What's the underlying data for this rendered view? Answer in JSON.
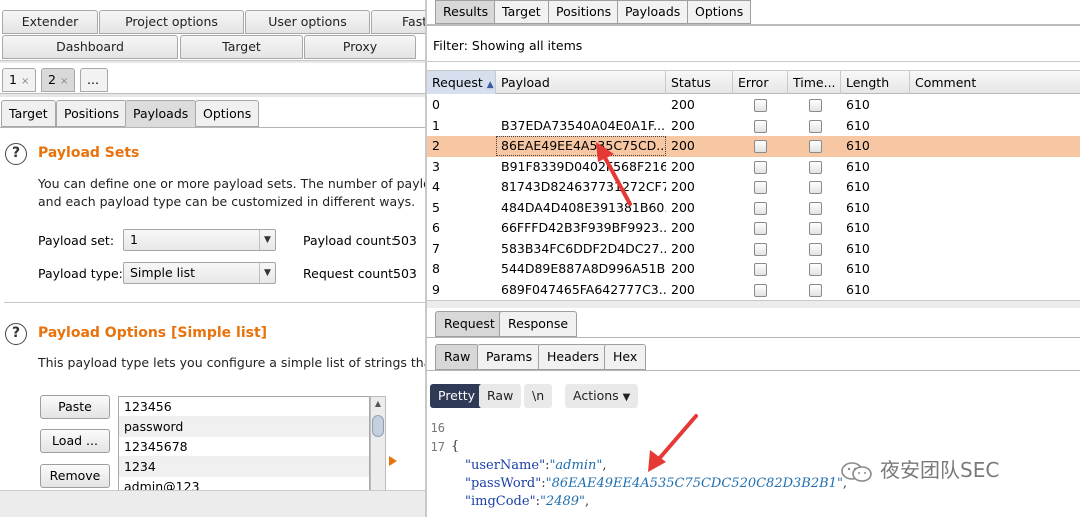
{
  "left": {
    "top_tabs_row1": [
      "Extender",
      "Project options",
      "User options",
      "Fast"
    ],
    "top_tabs_row2": [
      "Dashboard",
      "Target",
      "Proxy"
    ],
    "num_tabs": [
      {
        "label": "1",
        "close": "×"
      },
      {
        "label": "2",
        "close": "×"
      },
      {
        "label": "..."
      }
    ],
    "sub_tabs": [
      "Target",
      "Positions",
      "Payloads",
      "Options"
    ],
    "payload_sets": {
      "title": "Payload Sets",
      "desc1": "You can define one or more payload sets. The number of payload se",
      "desc2": "and each payload type can be customized in different ways.",
      "set_label": "Payload set:",
      "set_value": "1",
      "count_label": "Payload count:",
      "count_value": "503",
      "type_label": "Payload type:",
      "type_value": "Simple list",
      "req_label": "Request count:",
      "req_value": "503"
    },
    "payload_options": {
      "title": "Payload Options [Simple list]",
      "desc": "This payload type lets you configure a simple list of strings that are u",
      "buttons": [
        "Paste",
        "Load ...",
        "Remove"
      ],
      "items": [
        "123456",
        "password",
        "12345678",
        "1234",
        "admin@123"
      ]
    }
  },
  "right": {
    "tabs": [
      "Results",
      "Target",
      "Positions",
      "Payloads",
      "Options"
    ],
    "filter": "Filter: Showing all items",
    "columns": [
      "Request",
      "Payload",
      "Status",
      "Error",
      "Time...",
      "Length",
      "Comment"
    ],
    "sort_indicator": "▲",
    "rows": [
      {
        "req": "0",
        "payload": "",
        "status": "200",
        "length": "610"
      },
      {
        "req": "1",
        "payload": "B37EDA73540A04E0A1F...",
        "status": "200",
        "length": "610"
      },
      {
        "req": "2",
        "payload": "86EAE49EE4A535C75CD...",
        "status": "200",
        "length": "610"
      },
      {
        "req": "3",
        "payload": "B91F8339D0402F568F216...",
        "status": "200",
        "length": "610"
      },
      {
        "req": "4",
        "payload": "81743D824637731272CF7...",
        "status": "200",
        "length": "610"
      },
      {
        "req": "5",
        "payload": "484DA4D408E391381B60...",
        "status": "200",
        "length": "610"
      },
      {
        "req": "6",
        "payload": "66FFFD42B3F939BF9923...",
        "status": "200",
        "length": "610"
      },
      {
        "req": "7",
        "payload": "583B34FC6DDF2D4DC27...",
        "status": "200",
        "length": "610"
      },
      {
        "req": "8",
        "payload": "544D89E887A8D996A51B...",
        "status": "200",
        "length": "610"
      },
      {
        "req": "9",
        "payload": "689F047465FA642777C3...",
        "status": "200",
        "length": "610"
      }
    ],
    "selected_row": 2,
    "req_tabs": [
      "Request",
      "Response"
    ],
    "view_tabs": [
      "Raw",
      "Params",
      "Headers",
      "Hex"
    ],
    "format_buttons": {
      "pretty": "Pretty",
      "raw": "Raw",
      "newline": "\\n",
      "actions": "Actions"
    },
    "code": {
      "lines": [
        {
          "num": "16",
          "text": ""
        },
        {
          "num": "17",
          "text": "{"
        }
      ],
      "username_key": "\"userName\"",
      "username_val": "\"admin\"",
      "password_key": "\"passWord\"",
      "password_val": "\"86EAE49EE4A535C75CDC520C82D3B2B1\"",
      "imgcode_key": "\"imgCode\"",
      "imgcode_val": "\"2489\""
    }
  },
  "watermark": "夜安团队SEC",
  "colors": {
    "accent_orange": "#e8720c",
    "selected_row": "#f7c7a3",
    "arrow_red": "#e53935",
    "pretty_btn": "#2e3a56"
  }
}
